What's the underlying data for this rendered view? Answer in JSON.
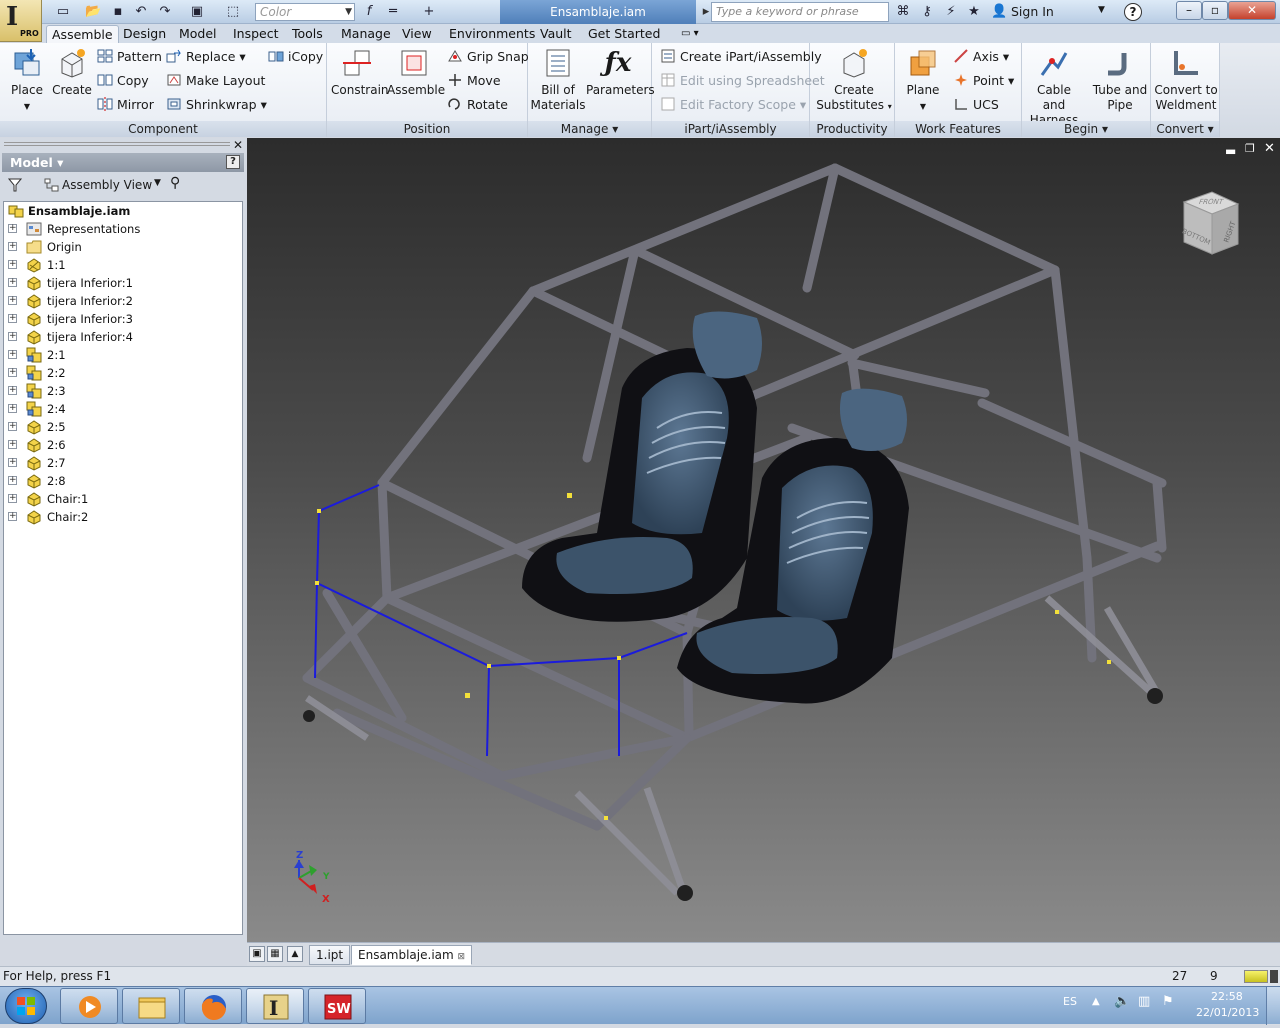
{
  "app": {
    "logo_letter": "I",
    "logo_badge": "PRO",
    "document_title": "Ensamblaje.iam",
    "color_box": "Color",
    "search_placeholder": "Type a keyword or phrase",
    "sign_in": "Sign In"
  },
  "menu_tabs": [
    "Assemble",
    "Design",
    "Model",
    "Inspect",
    "Tools",
    "Manage",
    "View",
    "Environments",
    "Vault",
    "Get Started"
  ],
  "ribbon": {
    "component": {
      "title": "Component",
      "place": "Place",
      "create": "Create",
      "pattern": "Pattern",
      "copy": "Copy",
      "mirror": "Mirror",
      "replace": "Replace",
      "make_layout": "Make Layout",
      "shrinkwrap": "Shrinkwrap",
      "icopy": "iCopy"
    },
    "position": {
      "title": "Position",
      "constrain": "Constrain",
      "assemble": "Assemble",
      "grip_snap": "Grip Snap",
      "move": "Move",
      "rotate": "Rotate"
    },
    "manage": {
      "title": "Manage",
      "bom_1": "Bill of",
      "bom_2": "Materials",
      "parameters": "Parameters"
    },
    "ipart": {
      "title": "iPart/iAssembly",
      "create": "Create iPart/iAssembly",
      "edit_spreadsheet": "Edit using Spreadsheet",
      "edit_factory": "Edit Factory Scope"
    },
    "productivity": {
      "title": "Productivity",
      "create_sub_1": "Create",
      "create_sub_2": "Substitutes"
    },
    "work_features": {
      "title": "Work Features",
      "plane": "Plane",
      "axis": "Axis",
      "point": "Point",
      "ucs": "UCS"
    },
    "begin": {
      "title": "Begin",
      "cable_1": "Cable and",
      "cable_2": "Harness",
      "tube_1": "Tube and",
      "tube_2": "Pipe"
    },
    "convert": {
      "title": "Convert",
      "weld_1": "Convert to",
      "weld_2": "Weldment"
    }
  },
  "browser": {
    "title": "Model",
    "view_mode": "Assembly View",
    "tree": [
      {
        "label": "Ensamblaje.iam",
        "icon": "assembly-icon",
        "root": true
      },
      {
        "label": "Representations",
        "icon": "representations-icon"
      },
      {
        "label": "Origin",
        "icon": "folder-icon"
      },
      {
        "label": "1:1",
        "icon": "part-icon-hatched"
      },
      {
        "label": "tijera Inferior:1",
        "icon": "part-icon"
      },
      {
        "label": "tijera Inferior:2",
        "icon": "part-icon"
      },
      {
        "label": "tijera Inferior:3",
        "icon": "part-icon"
      },
      {
        "label": "tijera Inferior:4",
        "icon": "part-icon"
      },
      {
        "label": "2:1",
        "icon": "subassembly-icon"
      },
      {
        "label": "2:2",
        "icon": "subassembly-icon"
      },
      {
        "label": "2:3",
        "icon": "subassembly-icon"
      },
      {
        "label": "2:4",
        "icon": "subassembly-icon"
      },
      {
        "label": "2:5",
        "icon": "part-icon"
      },
      {
        "label": "2:6",
        "icon": "part-icon"
      },
      {
        "label": "2:7",
        "icon": "part-icon"
      },
      {
        "label": "2:8",
        "icon": "part-icon"
      },
      {
        "label": "Chair:1",
        "icon": "part-icon"
      },
      {
        "label": "Chair:2",
        "icon": "part-icon"
      }
    ]
  },
  "viewcube": {
    "top": "FRONT",
    "left": "BOTTOM",
    "right": "RIGHT"
  },
  "axes": {
    "z": "Z",
    "x": "X",
    "y": "Y"
  },
  "doc_tabs": [
    "1.ipt",
    "Ensamblaje.iam"
  ],
  "status": {
    "help": "For Help, press F1",
    "count_a": "27",
    "count_b": "9"
  },
  "taskbar": {
    "lang": "ES",
    "time": "22:58",
    "date": "22/01/2013"
  },
  "colors": {
    "ribbon_bg": "#eef2f7",
    "viewport_top": "#2c2c2c",
    "viewport_bottom": "#8a8a8a",
    "tube": "#77777f",
    "sketch": "#1b1bdc",
    "seat": "#3f5670"
  }
}
